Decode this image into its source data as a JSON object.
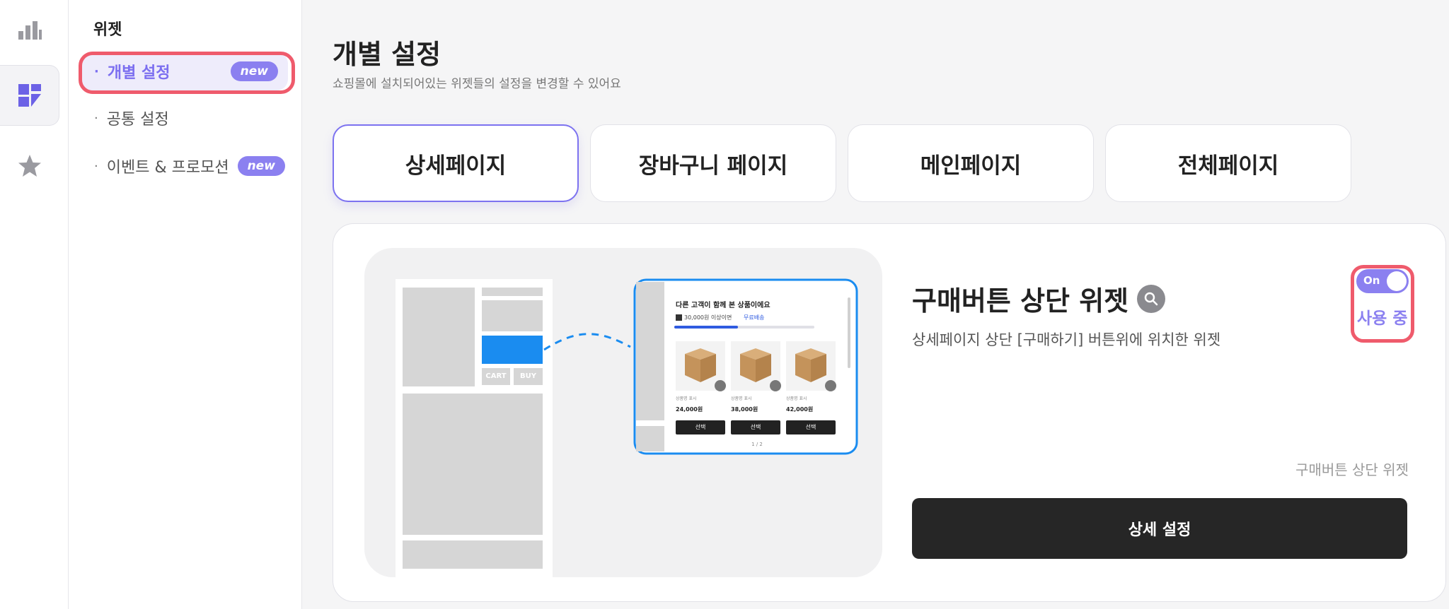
{
  "rail": {
    "items": [
      {
        "icon": "bar-chart-icon"
      },
      {
        "icon": "dashboard-icon",
        "active": true
      },
      {
        "icon": "star-icon"
      }
    ]
  },
  "submenu": {
    "title": "위젯",
    "items": [
      {
        "label": "개별 설정",
        "badge": "new",
        "active": true
      },
      {
        "label": "공통 설정"
      },
      {
        "label": "이벤트 & 프로모션",
        "badge": "new"
      }
    ]
  },
  "page": {
    "title": "개별 설정",
    "subtitle": "쇼핑몰에 설치되어있는 위젯들의 설정을 변경할 수 있어요"
  },
  "tabs": [
    {
      "label": "상세페이지",
      "active": true
    },
    {
      "label": "장바구니 페이지"
    },
    {
      "label": "메인페이지"
    },
    {
      "label": "전체페이지"
    }
  ],
  "widget": {
    "title": "구매버튼 상단 위젯",
    "description": "상세페이지 상단 [구매하기] 버튼위에 위치한 위젯",
    "toggle_text": "On",
    "status_label": "사용 중",
    "caption": "구매버튼 상단 위젯",
    "detail_button": "상세 설정"
  },
  "preview": {
    "cart_label": "CART",
    "buy_label": "BUY",
    "popup_title": "다른 고객이 함께 본 상품이에요",
    "shipping_text": "30,000원 이상이면",
    "shipping_highlight": "무료배송",
    "products": [
      {
        "name": "상품명 표시",
        "price": "24,000원",
        "button": "선택"
      },
      {
        "name": "상품명 표시",
        "price": "38,000원",
        "button": "선택"
      },
      {
        "name": "상품명 표시",
        "price": "42,000원",
        "button": "선택"
      }
    ],
    "pager": "1 / 2"
  },
  "colors": {
    "accent": "#8b80f0",
    "highlight": "#ef5b6c",
    "blue": "#1a8cf0",
    "dark_button": "#262626"
  }
}
